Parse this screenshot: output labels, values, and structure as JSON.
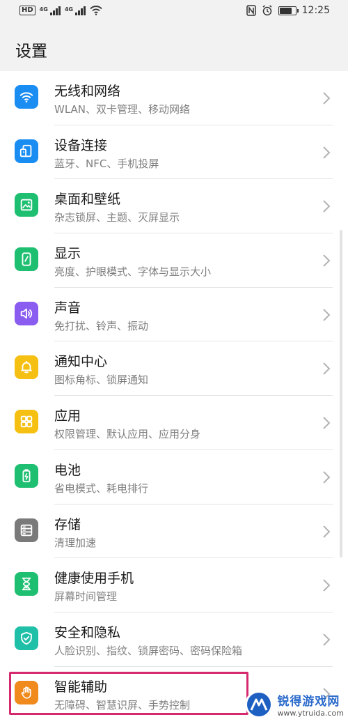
{
  "status_bar": {
    "left_badge": "HD",
    "network_1": "4G",
    "network_2": "4G",
    "time": "12:25",
    "battery_level": 0.85
  },
  "header": {
    "title": "设置"
  },
  "settings_items": [
    {
      "title": "无线和网络",
      "subtitle": "WLAN、双卡管理、移动网络",
      "icon": "wifi-icon",
      "color": "#1a8df2"
    },
    {
      "title": "设备连接",
      "subtitle": "蓝牙、NFC、手机投屏",
      "icon": "device-connection-icon",
      "color": "#1a8df2"
    },
    {
      "title": "桌面和壁纸",
      "subtitle": "杂志锁屏、主题、灭屏显示",
      "icon": "wallpaper-icon",
      "color": "#1fbf72"
    },
    {
      "title": "显示",
      "subtitle": "亮度、护眼模式、字体与显示大小",
      "icon": "display-icon",
      "color": "#1fbf72"
    },
    {
      "title": "声音",
      "subtitle": "免打扰、铃声、振动",
      "icon": "sound-icon",
      "color": "#8b5cf0"
    },
    {
      "title": "通知中心",
      "subtitle": "图标角标、锁屏通知",
      "icon": "notification-bell-icon",
      "color": "#f5c012"
    },
    {
      "title": "应用",
      "subtitle": "权限管理、默认应用、应用分身",
      "icon": "apps-grid-icon",
      "color": "#f5c012"
    },
    {
      "title": "电池",
      "subtitle": "省电模式、耗电排行",
      "icon": "battery-icon",
      "color": "#1fbf72"
    },
    {
      "title": "存储",
      "subtitle": "清理加速",
      "icon": "storage-icon",
      "color": "#7a7a7a"
    },
    {
      "title": "健康使用手机",
      "subtitle": "屏幕时间管理",
      "icon": "hourglass-icon",
      "color": "#1fbf72"
    },
    {
      "title": "安全和隐私",
      "subtitle": "人脸识别、指纹、锁屏密码、密码保险箱",
      "icon": "shield-check-icon",
      "color": "#1fbfa8"
    },
    {
      "title": "智能辅助",
      "subtitle": "无障碍、智慧识屏、手势控制",
      "icon": "hand-icon",
      "color": "#f08a1c"
    }
  ],
  "highlight_color": "#d6286e",
  "watermark": {
    "name": "锐得游戏网",
    "url": "www.ytruida.com"
  }
}
